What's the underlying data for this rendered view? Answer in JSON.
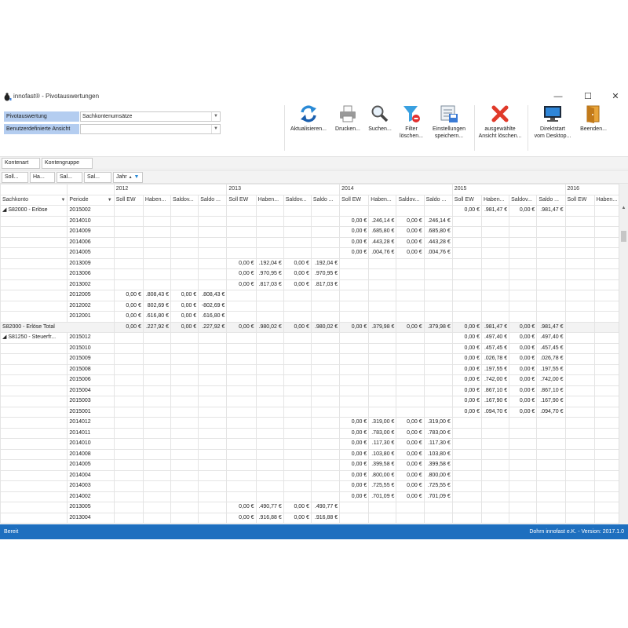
{
  "window": {
    "title": "innofast® - Pivotauswertungen",
    "controls": {
      "minimize": "—",
      "maximize": "☐",
      "close": "✕"
    }
  },
  "params": {
    "pivot_label": "Pivotauswertung",
    "pivot_value": "Sachkontenumsätze",
    "view_label": "Benutzerdefinierte Ansicht",
    "view_value": ""
  },
  "toolbar": [
    {
      "id": "refresh",
      "label": "Aktualisieren...",
      "icon": "refresh-icon"
    },
    {
      "id": "print",
      "label": "Drucken...",
      "icon": "printer-icon"
    },
    {
      "id": "search",
      "label": "Suchen...",
      "icon": "magnifier-icon"
    },
    {
      "id": "filter",
      "label": "Filter\nlöschen...",
      "icon": "filter-clear-icon"
    },
    {
      "id": "save",
      "label": "Einstellungen\nspeichern...",
      "icon": "save-settings-icon"
    },
    {
      "id": "delete",
      "label": "ausgewählte\nAnsicht löschen...",
      "icon": "delete-x-icon"
    },
    {
      "id": "desktop",
      "label": "Direktstart\nvom Desktop...",
      "icon": "monitor-icon"
    },
    {
      "id": "exit",
      "label": "Beenden...",
      "icon": "exit-door-icon"
    }
  ],
  "filter_fields": [
    "Kontenart",
    "Kontengruppe"
  ],
  "data_fields": [
    "Soll...",
    "Ha...",
    "Sal...",
    "Sal..."
  ],
  "column_field": "Jahr",
  "row_fields": [
    "Sachkonto",
    "Periode"
  ],
  "years": [
    "2012",
    "2013",
    "2014",
    "2015",
    "2016"
  ],
  "measures": [
    "Soll EW",
    "Haben...",
    "Saldov...",
    "Saldo ..."
  ],
  "rows": [
    {
      "konto": "◢ S82000 - Erlöse",
      "periode": "2015002",
      "v": [
        "",
        "",
        "",
        "",
        "",
        "",
        "",
        "",
        "",
        "",
        "",
        "",
        "0,00 €",
        ".981,47 €",
        "0,00 €",
        ".981,47 €"
      ]
    },
    {
      "konto": "",
      "periode": "2014010",
      "v": [
        "",
        "",
        "",
        "",
        "",
        "",
        "",
        "",
        "0,00 €",
        ".246,14 €",
        "0,00 €",
        ".246,14 €",
        "",
        "",
        "",
        ""
      ]
    },
    {
      "konto": "",
      "periode": "2014009",
      "v": [
        "",
        "",
        "",
        "",
        "",
        "",
        "",
        "",
        "0,00 €",
        ".685,80 €",
        "0,00 €",
        ".685,80 €",
        "",
        "",
        "",
        ""
      ]
    },
    {
      "konto": "",
      "periode": "2014006",
      "v": [
        "",
        "",
        "",
        "",
        "",
        "",
        "",
        "",
        "0,00 €",
        ".443,28 €",
        "0,00 €",
        ".443,28 €",
        "",
        "",
        "",
        ""
      ]
    },
    {
      "konto": "",
      "periode": "2014005",
      "v": [
        "",
        "",
        "",
        "",
        "",
        "",
        "",
        "",
        "0,00 €",
        ".004,76 €",
        "0,00 €",
        ".004,76 €",
        "",
        "",
        "",
        ""
      ]
    },
    {
      "konto": "",
      "periode": "2013009",
      "v": [
        "",
        "",
        "",
        "",
        "0,00 €",
        ".192,04 €",
        "0,00 €",
        ".192,04 €",
        "",
        "",
        "",
        "",
        "",
        "",
        "",
        ""
      ]
    },
    {
      "konto": "",
      "periode": "2013006",
      "v": [
        "",
        "",
        "",
        "",
        "0,00 €",
        ".970,95 €",
        "0,00 €",
        ".970,95 €",
        "",
        "",
        "",
        "",
        "",
        "",
        "",
        ""
      ]
    },
    {
      "konto": "",
      "periode": "2013002",
      "v": [
        "",
        "",
        "",
        "",
        "0,00 €",
        ".817,03 €",
        "0,00 €",
        ".817,03 €",
        "",
        "",
        "",
        "",
        "",
        "",
        "",
        ""
      ]
    },
    {
      "konto": "",
      "periode": "2012005",
      "v": [
        "0,00 €",
        ".808,43 €",
        "0,00 €",
        ".808,43 €",
        "",
        "",
        "",
        "",
        "",
        "",
        "",
        "",
        "",
        "",
        "",
        ""
      ]
    },
    {
      "konto": "",
      "periode": "2012002",
      "v": [
        "0,00 €",
        "802,69 €",
        "0,00 €",
        "-802,69 €",
        "",
        "",
        "",
        "",
        "",
        "",
        "",
        "",
        "",
        "",
        "",
        ""
      ]
    },
    {
      "konto": "",
      "periode": "2012001",
      "v": [
        "0,00 €",
        ".616,80 €",
        "0,00 €",
        ".616,80 €",
        "",
        "",
        "",
        "",
        "",
        "",
        "",
        "",
        "",
        "",
        "",
        ""
      ]
    },
    {
      "konto": "S82000 - Erlöse Total",
      "periode": "",
      "total": true,
      "v": [
        "0,00 €",
        ".227,92 €",
        "0,00 €",
        ".227,92 €",
        "0,00 €",
        ".980,02 €",
        "0,00 €",
        ".980,02 €",
        "0,00 €",
        ".379,98 €",
        "0,00 €",
        ".379,98 €",
        "0,00 €",
        ".981,47 €",
        "0,00 €",
        ".981,47 €"
      ]
    },
    {
      "konto": "◢ S81250 - Steuerfr...",
      "periode": "2015012",
      "v": [
        "",
        "",
        "",
        "",
        "",
        "",
        "",
        "",
        "",
        "",
        "",
        "",
        "0,00 €",
        ".497,40 €",
        "0,00 €",
        ".497,40 €"
      ]
    },
    {
      "konto": "",
      "periode": "2015010",
      "v": [
        "",
        "",
        "",
        "",
        "",
        "",
        "",
        "",
        "",
        "",
        "",
        "",
        "0,00 €",
        ".457,45 €",
        "0,00 €",
        ".457,45 €"
      ]
    },
    {
      "konto": "",
      "periode": "2015009",
      "v": [
        "",
        "",
        "",
        "",
        "",
        "",
        "",
        "",
        "",
        "",
        "",
        "",
        "0,00 €",
        ".026,78 €",
        "0,00 €",
        ".026,78 €"
      ]
    },
    {
      "konto": "",
      "periode": "2015008",
      "v": [
        "",
        "",
        "",
        "",
        "",
        "",
        "",
        "",
        "",
        "",
        "",
        "",
        "0,00 €",
        ".197,55 €",
        "0,00 €",
        ".197,55 €"
      ]
    },
    {
      "konto": "",
      "periode": "2015006",
      "v": [
        "",
        "",
        "",
        "",
        "",
        "",
        "",
        "",
        "",
        "",
        "",
        "",
        "0,00 €",
        ".742,00 €",
        "0,00 €",
        ".742,00 €"
      ]
    },
    {
      "konto": "",
      "periode": "2015004",
      "v": [
        "",
        "",
        "",
        "",
        "",
        "",
        "",
        "",
        "",
        "",
        "",
        "",
        "0,00 €",
        ".867,10 €",
        "0,00 €",
        ".867,10 €"
      ]
    },
    {
      "konto": "",
      "periode": "2015003",
      "v": [
        "",
        "",
        "",
        "",
        "",
        "",
        "",
        "",
        "",
        "",
        "",
        "",
        "0,00 €",
        ".167,90 €",
        "0,00 €",
        ".167,90 €"
      ]
    },
    {
      "konto": "",
      "periode": "2015001",
      "v": [
        "",
        "",
        "",
        "",
        "",
        "",
        "",
        "",
        "",
        "",
        "",
        "",
        "0,00 €",
        ".094,70 €",
        "0,00 €",
        ".094,70 €"
      ]
    },
    {
      "konto": "",
      "periode": "2014012",
      "v": [
        "",
        "",
        "",
        "",
        "",
        "",
        "",
        "",
        "0,00 €",
        ".319,00 €",
        "0,00 €",
        ".319,00 €",
        "",
        "",
        "",
        ""
      ]
    },
    {
      "konto": "",
      "periode": "2014011",
      "v": [
        "",
        "",
        "",
        "",
        "",
        "",
        "",
        "",
        "0,00 €",
        ".783,00 €",
        "0,00 €",
        ".783,00 €",
        "",
        "",
        "",
        ""
      ]
    },
    {
      "konto": "",
      "periode": "2014010",
      "v": [
        "",
        "",
        "",
        "",
        "",
        "",
        "",
        "",
        "0,00 €",
        ".117,30 €",
        "0,00 €",
        ".117,30 €",
        "",
        "",
        "",
        ""
      ]
    },
    {
      "konto": "",
      "periode": "2014008",
      "v": [
        "",
        "",
        "",
        "",
        "",
        "",
        "",
        "",
        "0,00 €",
        ".103,80 €",
        "0,00 €",
        ".103,80 €",
        "",
        "",
        "",
        ""
      ]
    },
    {
      "konto": "",
      "periode": "2014005",
      "v": [
        "",
        "",
        "",
        "",
        "",
        "",
        "",
        "",
        "0,00 €",
        ".399,58 €",
        "0,00 €",
        ".399,58 €",
        "",
        "",
        "",
        ""
      ]
    },
    {
      "konto": "",
      "periode": "2014004",
      "v": [
        "",
        "",
        "",
        "",
        "",
        "",
        "",
        "",
        "0,00 €",
        ".800,00 €",
        "0,00 €",
        ".800,00 €",
        "",
        "",
        "",
        ""
      ]
    },
    {
      "konto": "",
      "periode": "2014003",
      "v": [
        "",
        "",
        "",
        "",
        "",
        "",
        "",
        "",
        "0,00 €",
        ".725,55 €",
        "0,00 €",
        ".725,55 €",
        "",
        "",
        "",
        ""
      ]
    },
    {
      "konto": "",
      "periode": "2014002",
      "v": [
        "",
        "",
        "",
        "",
        "",
        "",
        "",
        "",
        "0,00 €",
        ".701,09 €",
        "0,00 €",
        ".701,09 €",
        "",
        "",
        "",
        ""
      ]
    },
    {
      "konto": "",
      "periode": "2013005",
      "v": [
        "",
        "",
        "",
        "",
        "0,00 €",
        ".490,77 €",
        "0,00 €",
        ".490,77 €",
        "",
        "",
        "",
        "",
        "",
        "",
        "",
        ""
      ]
    },
    {
      "konto": "",
      "periode": "2013004",
      "v": [
        "",
        "",
        "",
        "",
        "0,00 €",
        ".916,88 €",
        "0,00 €",
        ".916,88 €",
        "",
        "",
        "",
        "",
        "",
        "",
        "",
        ""
      ]
    }
  ],
  "status": {
    "left": "Bereit",
    "right": "Dohrn innofast e.K. - Version: 2017.1.0"
  },
  "colors": {
    "statusbar": "#1e6fbf",
    "label_bg": "#b4cdf0",
    "total_bg": "#f3f3f3"
  }
}
